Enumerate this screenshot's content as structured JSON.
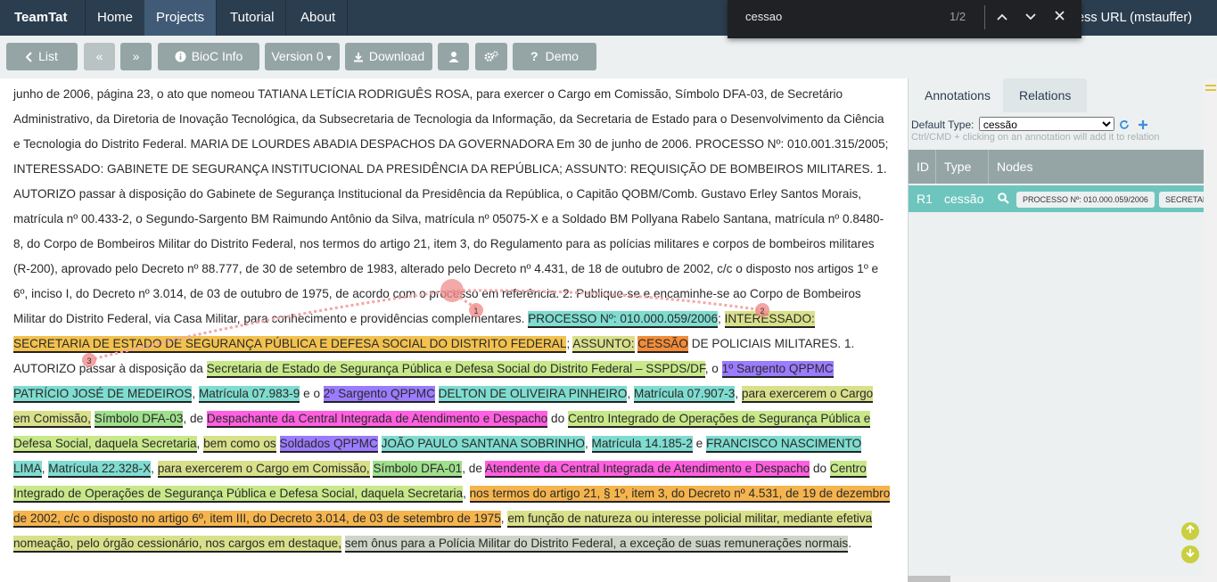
{
  "navbar": {
    "brand": "TeamTat",
    "links": [
      "Home",
      "Projects",
      "Tutorial",
      "About"
    ],
    "user_partial": "cess URL (mstauffer)"
  },
  "findbar": {
    "query": "cessao",
    "count": "1/2"
  },
  "toolbar": {
    "list": "List",
    "bioc": "BioC Info",
    "version": "Version 0",
    "download": "Download",
    "demo": "Demo"
  },
  "document": {
    "t01": "junho de 2006, página 23, o ato que nomeou TATIANA LETÍCIA RODRIGUÊS ROSA, para exercer o Cargo em Comissão, Símbolo DFA-03, de Secretário Administrativo, da Diretoria de Inovação Tecnológica, da Subsecretaria de Tecnologia da Informação, da Secretaria de Estado para o Desenvolvimento da Ciência e Tecnologia do Distrito Federal. MARIA DE LOURDES ABADIA DESPACHOS DA GOVERNADORA Em 30 de junho de 2006. PROCESSO Nº: 010.001.315/2005; INTERESSADO: GABINETE DE SEGURANÇA INSTITUCIONAL DA PRESIDÊNCIA DA REPÚBLICA; ASSUNTO: REQUISIÇÃO DE BOMBEIROS MILITARES. 1. AUTORIZO passar à disposição do Gabinete de Segurança Institucional da Presidência da República, o Capitão QOBM/Comb. Gustavo Erley Santos Morais, matrícula nº 00.433-2, o Segundo-Sargento BM Raimundo Antônio da Silva, matrícula nº 05075-X e a Soldado BM Pollyana Rabelo Santana, matrícula nº 0.8480-8, do Corpo de Bombeiros Militar do Distrito Federal, nos termos do artigo 21, item 3, do Regulamento para as polícias militares e corpos de bombeiros militares (R-200), aprovado pelo Decreto nº 88.777, de 30 de setembro de 1983, alterado pelo Decreto nº 4.431, de 18 de outubro de 2002, c/c o disposto nos artigos 1º e 6º, inciso I, do Decreto nº 3.014, de 03 de outubro de 1975, de acordo com o processo em referência. 2. Publique-se e encaminhe-se ao Corpo de Bombeiros Militar do Distrito Federal, via Casa Militar, para conhecimento e providências complementares. ",
    "a01": "PROCESSO Nº: 010.000.059/2006",
    "t02": "; ",
    "a02": "INTERESSADO:",
    "t03": " ",
    "a03": "SECRETARIA DE ESTADO DE SEGURANÇA PÚBLICA E DEFESA SOCIAL DO DISTRITO FEDERAL",
    "t04": "; ",
    "a04": "ASSUNTO:",
    "t05": " ",
    "a05": "CESSÃO",
    "t06": " DE POLICIAIS MILITARES. 1. AUTORIZO passar à disposição da ",
    "a06": "Secretaria de Estado de Segurança Pública e Defesa Social do Distrito Federal – SSPDS/DF",
    "t07": ", o ",
    "a07": "1º Sargento QPPMC",
    "t08": " ",
    "a08": "PATRÍCIO JOSÉ DE MEDEIROS",
    "t09": ", ",
    "a09": "Matrícula 07.983-9",
    "t10": " e o ",
    "a10": "2º Sargento QPPMC",
    "t11": " ",
    "a11": "DELTON DE OLIVEIRA PINHEIRO",
    "t12": ", ",
    "a12": "Matrícula 07.907-3",
    "t13": ", ",
    "a13": "para exercerem o Cargo em Comissão,",
    "t14": " ",
    "a14": "Símbolo DFA-03",
    "t15": ", de ",
    "a15": "Despachante da Central Integrada de Atendimento e Despacho",
    "t16": " do ",
    "a16": "Centro Integrado de Operações de Segurança Pública e Defesa Social, daquela Secretaria",
    "t17": ", ",
    "a17": "bem como os",
    "t18": " ",
    "a18": "Soldados QPPMC",
    "t19": " ",
    "a19": "JOÃO PAULO SANTANA SOBRINHO",
    "t20": ", ",
    "a20": "Matrícula 14.185-2",
    "t21": " e ",
    "a21": "FRANCISCO NASCIMENTO LIMA",
    "t22": ", ",
    "a22": "Matrícula 22.328-X",
    "t23": ", ",
    "a23": "para exercerem o Cargo em Comissão,",
    "t24": " ",
    "a24": "Símbolo DFA-01",
    "t25": ", de ",
    "a25": "Atendente da Central Integrada de Atendimento e Despacho",
    "t26": " do ",
    "a26": "Centro Integrado de Operações de Segurança Pública e Defesa Social, daquela Secretaria",
    "t27": ", ",
    "a27": "nos termos do artigo 21, § 1º, item 3, do Decreto nº 4.531, de 19 de dezembro de 2002, c/c o disposto no artigo 6º, item III, do Decreto 3.014, de 03 de setembro de 1975",
    "t28": ", ",
    "a28": "em função de natureza ou interesse policial militar, mediante efetiva nomeação, pelo órgão cessionário, nos cargos em destaque,",
    "t29": " ",
    "a29": "sem ônus para a Polícia Militar do Distrito Federal, a exceção de suas remunerações normais",
    "t30": "."
  },
  "relation_markers": [
    "1",
    "2",
    "3"
  ],
  "panel": {
    "tabs": [
      "Annotations",
      "Relations"
    ],
    "active_tab": "Relations",
    "default_type_label": "Default Type:",
    "default_type_value": "cessão",
    "hint": "Ctrl/CMD + clicking on an annotation will add it to relation",
    "columns": [
      "ID",
      "Type",
      "Nodes"
    ],
    "rows": [
      {
        "id": "R1",
        "type": "cessão",
        "nodes": [
          "PROCESSO Nº: 010.000.059/2006",
          "SECRETARIA"
        ]
      }
    ]
  },
  "colors": {
    "navbar": "#2b3e50",
    "toolbar_button": "#95a5a6",
    "relation_row": "#6ec5bd",
    "relation_line": "#ef7b7b"
  }
}
